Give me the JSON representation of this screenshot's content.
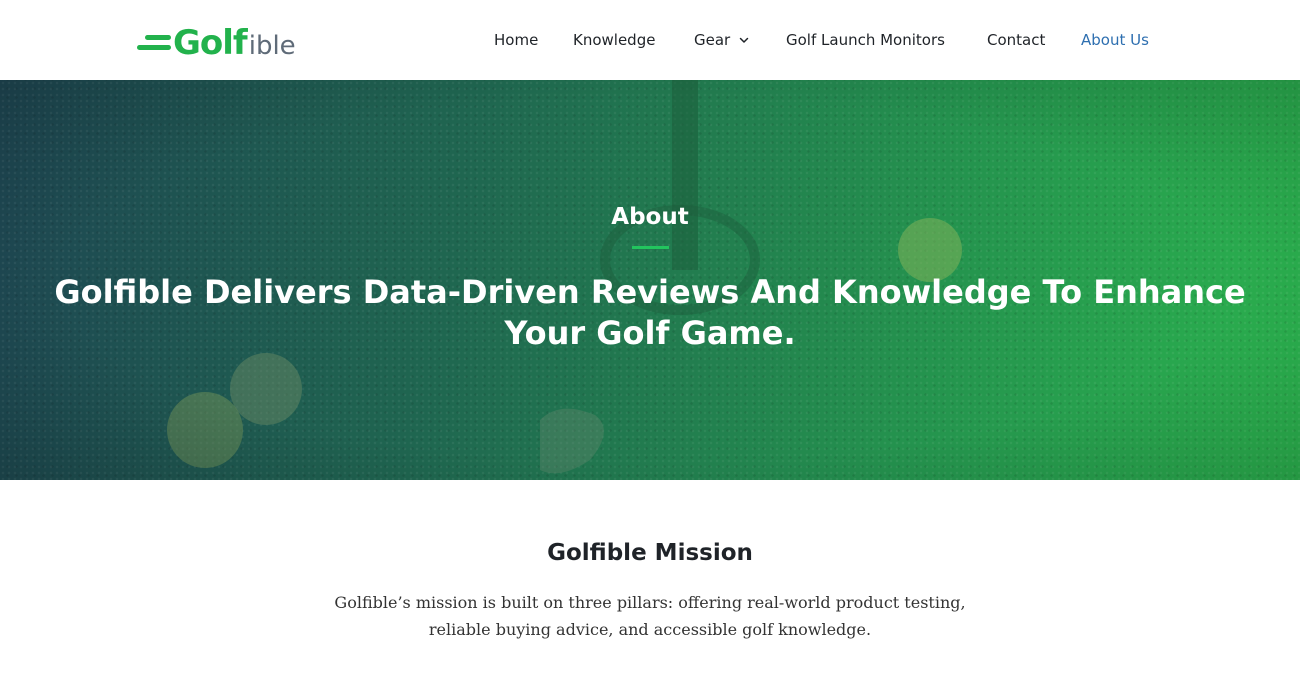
{
  "brand": {
    "logo_primary": "Golf",
    "logo_secondary": "ible",
    "accent": "#22b24c"
  },
  "nav": {
    "items": [
      {
        "label": "Home"
      },
      {
        "label": "Knowledge"
      },
      {
        "label": "Gear",
        "has_dropdown": true
      },
      {
        "label": "Golf Launch Monitors"
      },
      {
        "label": "Contact"
      },
      {
        "label": "About Us",
        "active": true
      }
    ],
    "active_color": "#2e6fb0"
  },
  "hero": {
    "eyebrow": "About",
    "title": "Golfible Delivers Data-Driven Reviews And Knowledge To Enhance Your Golf Game."
  },
  "mission": {
    "title": "Golfible Mission",
    "text": "Golfible’s mission is built on three pillars: offering real-world product testing, reliable buying advice, and accessible golf knowledge."
  }
}
